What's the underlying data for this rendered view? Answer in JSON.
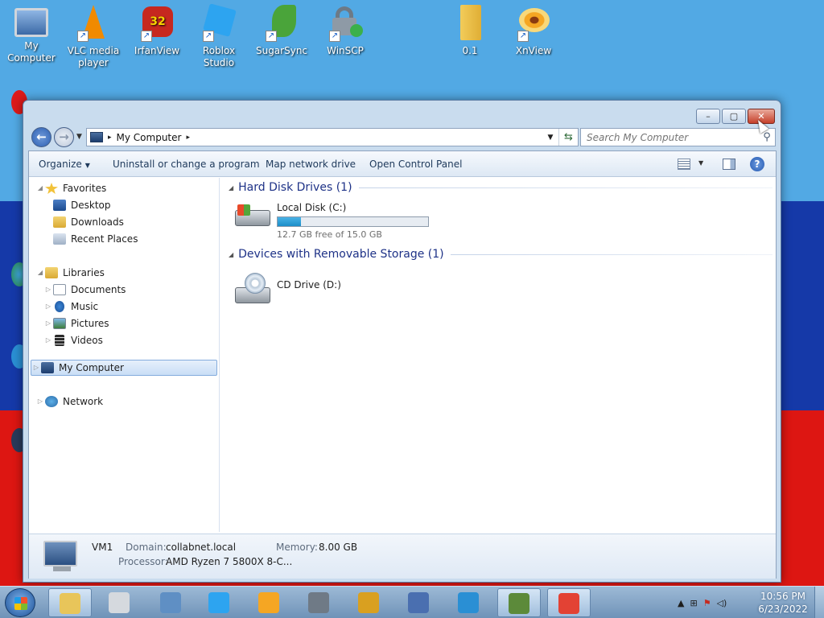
{
  "desktop": {
    "icons": [
      {
        "label": "My Computer",
        "icon": "my-computer-icon",
        "color": "#4a7fbf"
      },
      {
        "label": "VLC media player",
        "icon": "vlc-icon",
        "color": "#f08a00"
      },
      {
        "label": "IrfanView",
        "icon": "irfanview-icon",
        "color": "#c6281f"
      },
      {
        "label": "Roblox Studio",
        "icon": "roblox-studio-icon",
        "color": "#2da4f0"
      },
      {
        "label": "SugarSync",
        "icon": "sugarsync-icon",
        "color": "#4aa43a"
      },
      {
        "label": "WinSCP",
        "icon": "winscp-icon",
        "color": "#6d7a86"
      },
      {
        "label": "0.1",
        "icon": "folder-icon",
        "color": "#f2cc5a"
      },
      {
        "label": "XnView",
        "icon": "xnview-icon",
        "color": "#f5a623"
      }
    ],
    "background_colors": [
      "#52a9e4",
      "#1539a8",
      "#dd1612"
    ]
  },
  "window": {
    "title_buttons": {
      "minimize": "–",
      "maximize": "▢",
      "close": "✕"
    },
    "address": {
      "crumb": "My Computer",
      "separator": "▸"
    },
    "search": {
      "placeholder": "Search My Computer"
    },
    "commands": {
      "organize": "Organize",
      "uninstall": "Uninstall or change a program",
      "map_drive": "Map network drive",
      "control_panel": "Open Control Panel"
    },
    "nav": {
      "favorites": "Favorites",
      "desktop": "Desktop",
      "downloads": "Downloads",
      "recent": "Recent Places",
      "libraries": "Libraries",
      "documents": "Documents",
      "music": "Music",
      "pictures": "Pictures",
      "videos": "Videos",
      "computer": "My Computer",
      "network": "Network"
    },
    "groups": {
      "hdd": "Hard Disk Drives (1)",
      "removable": "Devices with Removable Storage (1)"
    },
    "drives": {
      "c_name": "Local Disk (C:)",
      "c_free": "12.7 GB free of 15.0 GB",
      "c_used_fraction": 0.153,
      "d_name": "CD Drive (D:)"
    },
    "details": {
      "name": "VM1",
      "domain_label": "Domain:",
      "domain_value": "collabnet.local",
      "memory_label": "Memory:",
      "memory_value": "8.00 GB",
      "processor_label": "Processor:",
      "processor_value": "AMD Ryzen 7 5800X 8-C..."
    }
  },
  "taskbar": {
    "apps": [
      {
        "icon": "windows-explorer-icon",
        "active": true,
        "color": "#e8c55a"
      },
      {
        "icon": "blank-app-icon",
        "active": false,
        "color": "#d5d9de"
      },
      {
        "icon": "vmware-icon",
        "active": false,
        "color": "#5f8fc4"
      },
      {
        "icon": "roblox-icon",
        "active": false,
        "color": "#2da4f0"
      },
      {
        "icon": "xnview-icon",
        "active": false,
        "color": "#f5a623"
      },
      {
        "icon": "google-earth-pro-icon",
        "active": false,
        "color": "#6f7a86"
      },
      {
        "icon": "winamp-icon",
        "active": false,
        "color": "#d9a020"
      },
      {
        "icon": "network-tool-icon",
        "active": false,
        "color": "#4a6fb0"
      },
      {
        "icon": "edge-icon",
        "active": false,
        "color": "#2a8fd4"
      },
      {
        "icon": "tree-app-icon",
        "active": true,
        "color": "#5c8a3a"
      },
      {
        "icon": "chrome-icon",
        "active": true,
        "color": "#e34234"
      }
    ],
    "clock_time": "10:56 PM",
    "clock_date": "6/23/2022"
  }
}
